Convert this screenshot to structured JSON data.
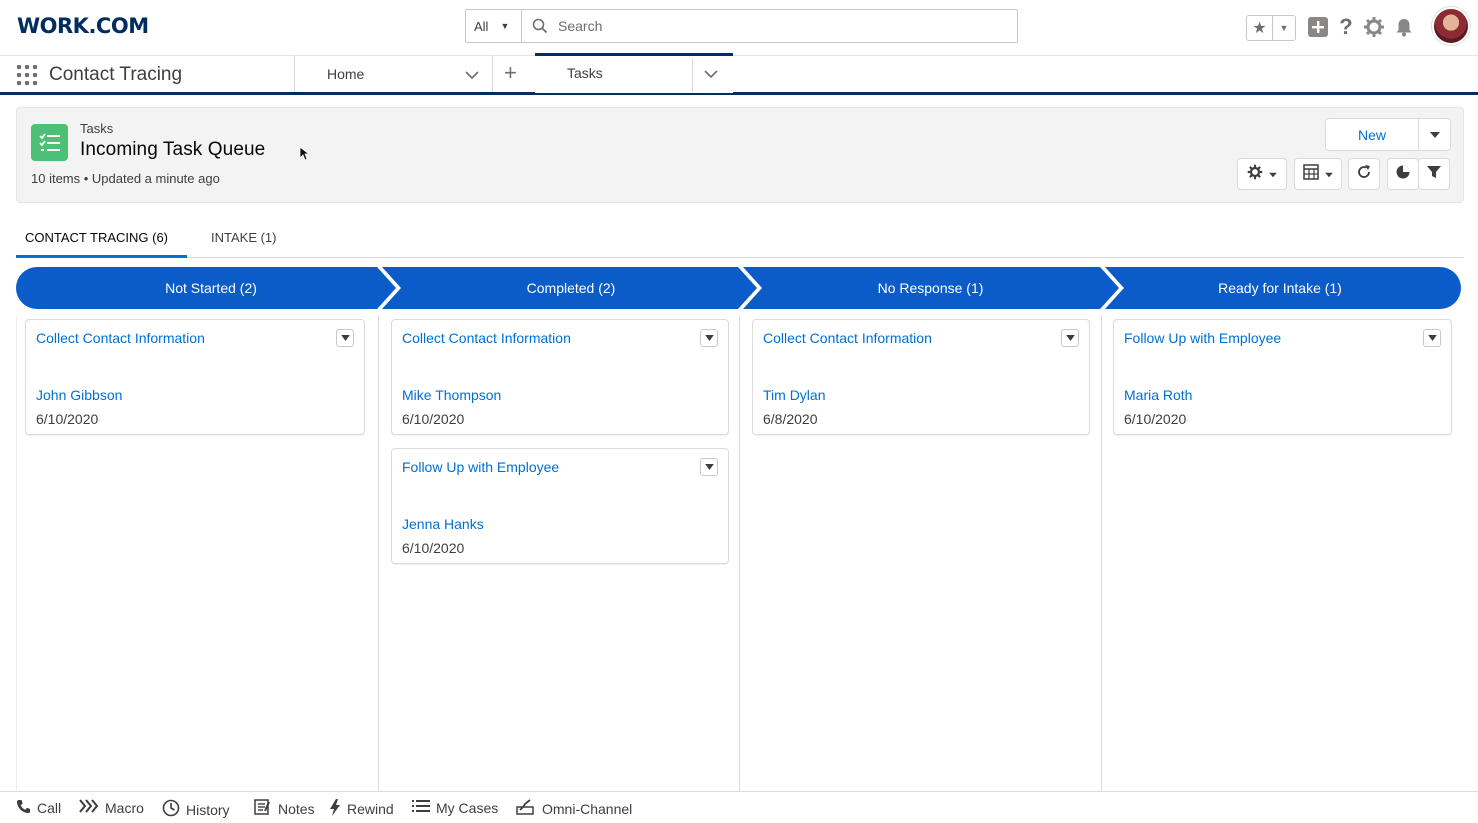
{
  "header": {
    "logo": "WORK.COM",
    "search_scope": "All",
    "search_placeholder": "Search"
  },
  "nav": {
    "app_name": "Contact Tracing",
    "tabs": [
      {
        "label": "Home"
      },
      {
        "label": "Tasks",
        "active": true
      }
    ]
  },
  "page_header": {
    "object_label": "Tasks",
    "title": "Incoming Task Queue",
    "meta": "10 items • Updated a minute ago",
    "new_label": "New"
  },
  "sub_tabs": [
    {
      "label": "CONTACT TRACING (6)",
      "active": true
    },
    {
      "label": "INTAKE (1)",
      "active": false
    }
  ],
  "kanban": {
    "columns": [
      {
        "label": "Not Started (2)",
        "cards": [
          {
            "title": "Collect Contact Information",
            "contact": "John Gibbson",
            "date": "6/10/2020"
          }
        ]
      },
      {
        "label": "Completed (2)",
        "cards": [
          {
            "title": "Collect Contact Information",
            "contact": "Mike Thompson",
            "date": "6/10/2020"
          },
          {
            "title": "Follow Up with Employee",
            "contact": "Jenna Hanks",
            "date": "6/10/2020"
          }
        ]
      },
      {
        "label": "No Response (1)",
        "cards": [
          {
            "title": "Collect Contact Information",
            "contact": "Tim Dylan",
            "date": "6/8/2020"
          }
        ]
      },
      {
        "label": "Ready for Intake (1)",
        "cards": [
          {
            "title": "Follow Up with Employee",
            "contact": "Maria Roth",
            "date": "6/10/2020"
          }
        ]
      }
    ]
  },
  "utility_bar": {
    "items": [
      {
        "label": "Call",
        "icon": "phone-icon"
      },
      {
        "label": "Macro",
        "icon": "macro-icon"
      },
      {
        "label": "History",
        "icon": "history-icon"
      },
      {
        "label": "Notes",
        "icon": "notes-icon"
      },
      {
        "label": "Rewind",
        "icon": "rewind-icon"
      },
      {
        "label": "My Cases",
        "icon": "list-icon"
      },
      {
        "label": "Omni-Channel",
        "icon": "omni-channel-icon"
      }
    ]
  },
  "colors": {
    "brand_navy": "#032d60",
    "path_blue": "#0b5cc8",
    "link_blue": "#0070d2",
    "object_icon_green": "#4bc076"
  }
}
